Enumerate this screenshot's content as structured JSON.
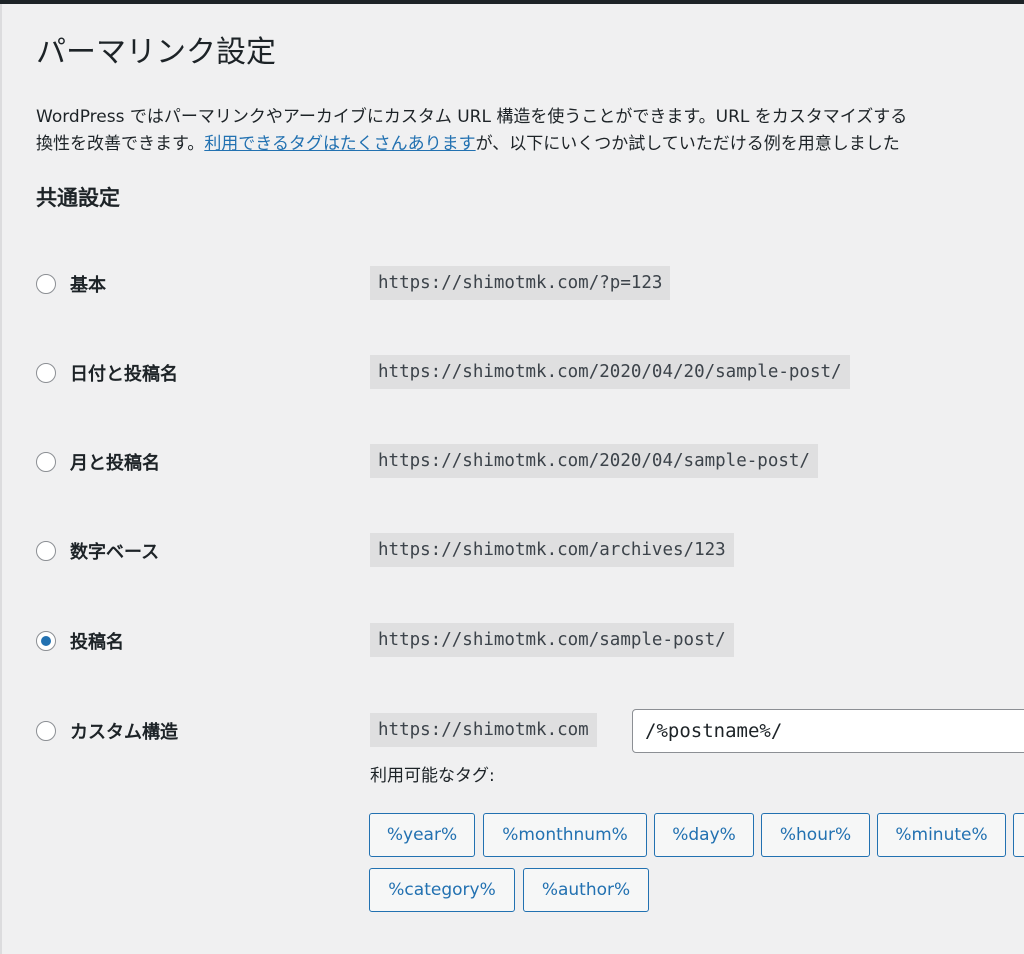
{
  "page": {
    "title": "パーマリンク設定",
    "description_line1": "WordPress ではパーマリンクやアーカイブにカスタム URL 構造を使うことができます。URL をカスタマイズする",
    "description_line2_before": "換性を改善できます。",
    "description_link": "利用できるタグはたくさんあります",
    "description_line2_after": "が、以下にいくつか試していただける例を用意しました"
  },
  "common_settings": {
    "heading": "共通設定",
    "options": [
      {
        "label": "基本",
        "example": "https://shimotmk.com/?p=123",
        "checked": false
      },
      {
        "label": "日付と投稿名",
        "example": "https://shimotmk.com/2020/04/20/sample-post/",
        "checked": false
      },
      {
        "label": "月と投稿名",
        "example": "https://shimotmk.com/2020/04/sample-post/",
        "checked": false
      },
      {
        "label": "数字ベース",
        "example": "https://shimotmk.com/archives/123",
        "checked": false
      },
      {
        "label": "投稿名",
        "example": "https://shimotmk.com/sample-post/",
        "checked": true
      },
      {
        "label": "カスタム構造",
        "example": "https://shimotmk.com",
        "checked": false
      }
    ],
    "custom_structure_value": "/%postname%/",
    "available_tags_label": "利用可能なタグ:",
    "tags": [
      "%year%",
      "%monthnum%",
      "%day%",
      "%hour%",
      "%minute%",
      "",
      "%category%",
      "%author%"
    ]
  },
  "colors": {
    "accent": "#2271b1",
    "background": "#f0f0f1"
  }
}
